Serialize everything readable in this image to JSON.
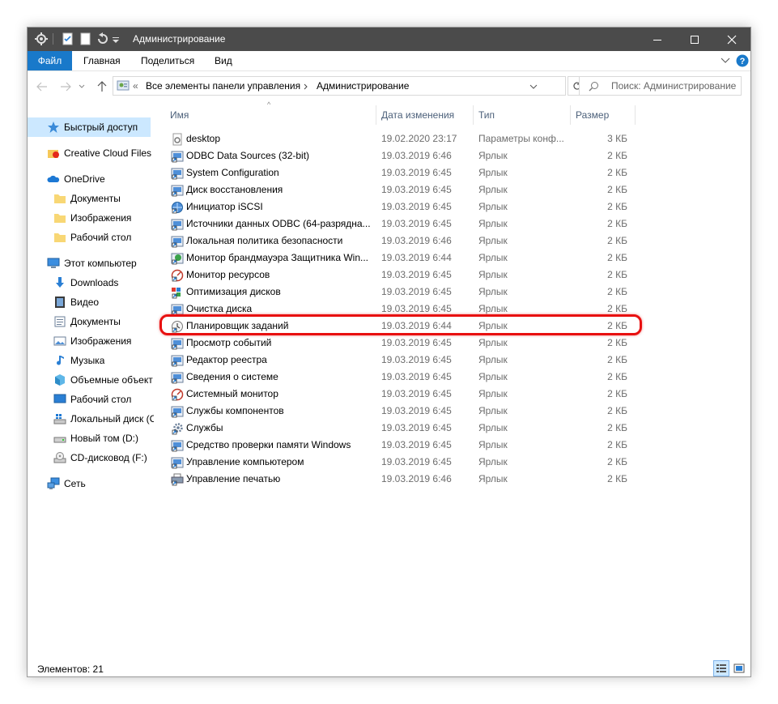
{
  "window": {
    "title": "Администрирование"
  },
  "ribbon": {
    "tabs": [
      "Файл",
      "Главная",
      "Поделиться",
      "Вид"
    ]
  },
  "address": {
    "crumbs": [
      "Все элементы панели управления",
      "Администрирование"
    ],
    "more_glyph": "«"
  },
  "search": {
    "placeholder": "Поиск: Администрирование"
  },
  "nav": {
    "items": [
      {
        "label": "Быстрый доступ",
        "icon": "star-icon",
        "selected": true
      },
      {
        "label": "Creative Cloud Files",
        "icon": "creative-cloud-icon"
      },
      {
        "label": "OneDrive",
        "icon": "onedrive-cloud-icon"
      },
      {
        "label": "Документы",
        "icon": "folder-icon"
      },
      {
        "label": "Изображения",
        "icon": "folder-icon"
      },
      {
        "label": "Рабочий стол",
        "icon": "folder-icon"
      },
      {
        "label": "Этот компьютер",
        "icon": "computer-icon"
      },
      {
        "label": "Downloads",
        "icon": "download-arrow-icon"
      },
      {
        "label": "Видео",
        "icon": "video-icon"
      },
      {
        "label": "Документы",
        "icon": "documents-icon"
      },
      {
        "label": "Изображения",
        "icon": "pictures-icon"
      },
      {
        "label": "Музыка",
        "icon": "music-icon"
      },
      {
        "label": "Объемные объект",
        "icon": "3d-objects-icon"
      },
      {
        "label": "Рабочий стол",
        "icon": "desktop-icon"
      },
      {
        "label": "Локальный диск (С",
        "icon": "windows-drive-icon"
      },
      {
        "label": "Новый том (D:)",
        "icon": "drive-icon"
      },
      {
        "label": "CD-дисковод (F:)",
        "icon": "cd-drive-icon"
      },
      {
        "label": "Сеть",
        "icon": "network-icon"
      }
    ]
  },
  "columns": {
    "name": "Имя",
    "date": "Дата изменения",
    "type": "Тип",
    "size": "Размер"
  },
  "files": [
    {
      "name": "desktop",
      "date": "19.02.2020 23:17",
      "type": "Параметры конф...",
      "size": "3 КБ",
      "icon": "settings-file-icon"
    },
    {
      "name": "ODBC Data Sources (32-bit)",
      "date": "19.03.2019 6:46",
      "type": "Ярлык",
      "size": "2 КБ",
      "icon": "shortcut-icon"
    },
    {
      "name": "System Configuration",
      "date": "19.03.2019 6:45",
      "type": "Ярлык",
      "size": "2 КБ",
      "icon": "shortcut-icon"
    },
    {
      "name": "Диск восстановления",
      "date": "19.03.2019 6:45",
      "type": "Ярлык",
      "size": "2 КБ",
      "icon": "shortcut-icon"
    },
    {
      "name": "Инициатор iSCSI",
      "date": "19.03.2019 6:45",
      "type": "Ярлык",
      "size": "2 КБ",
      "icon": "globe-shortcut-icon"
    },
    {
      "name": "Источники данных ODBC (64-разрядна...",
      "date": "19.03.2019 6:45",
      "type": "Ярлык",
      "size": "2 КБ",
      "icon": "shortcut-icon"
    },
    {
      "name": "Локальная политика безопасности",
      "date": "19.03.2019 6:46",
      "type": "Ярлык",
      "size": "2 КБ",
      "icon": "shortcut-icon"
    },
    {
      "name": "Монитор брандмауэра Защитника Win...",
      "date": "19.03.2019 6:44",
      "type": "Ярлык",
      "size": "2 КБ",
      "icon": "firewall-shortcut-icon"
    },
    {
      "name": "Монитор ресурсов",
      "date": "19.03.2019 6:45",
      "type": "Ярлык",
      "size": "2 КБ",
      "icon": "gauge-shortcut-icon"
    },
    {
      "name": "Оптимизация дисков",
      "date": "19.03.2019 6:45",
      "type": "Ярлык",
      "size": "2 КБ",
      "icon": "defrag-shortcut-icon"
    },
    {
      "name": "Очистка диска",
      "date": "19.03.2019 6:45",
      "type": "Ярлык",
      "size": "2 КБ",
      "icon": "shortcut-icon"
    },
    {
      "name": "Планировщик заданий",
      "date": "19.03.2019 6:44",
      "type": "Ярлык",
      "size": "2 КБ",
      "icon": "clock-shortcut-icon"
    },
    {
      "name": "Просмотр событий",
      "date": "19.03.2019 6:45",
      "type": "Ярлык",
      "size": "2 КБ",
      "icon": "shortcut-icon"
    },
    {
      "name": "Редактор реестра",
      "date": "19.03.2019 6:45",
      "type": "Ярлык",
      "size": "2 КБ",
      "icon": "shortcut-icon"
    },
    {
      "name": "Сведения о системе",
      "date": "19.03.2019 6:45",
      "type": "Ярлык",
      "size": "2 КБ",
      "icon": "shortcut-icon"
    },
    {
      "name": "Системный монитор",
      "date": "19.03.2019 6:45",
      "type": "Ярлык",
      "size": "2 КБ",
      "icon": "gauge-shortcut-icon"
    },
    {
      "name": "Службы компонентов",
      "date": "19.03.2019 6:45",
      "type": "Ярлык",
      "size": "2 КБ",
      "icon": "shortcut-icon"
    },
    {
      "name": "Службы",
      "date": "19.03.2019 6:45",
      "type": "Ярлык",
      "size": "2 КБ",
      "icon": "gear-shortcut-icon"
    },
    {
      "name": "Средство проверки памяти Windows",
      "date": "19.03.2019 6:45",
      "type": "Ярлык",
      "size": "2 КБ",
      "icon": "shortcut-icon"
    },
    {
      "name": "Управление компьютером",
      "date": "19.03.2019 6:45",
      "type": "Ярлык",
      "size": "2 КБ",
      "icon": "shortcut-icon"
    },
    {
      "name": "Управление печатью",
      "date": "19.03.2019 6:46",
      "type": "Ярлык",
      "size": "2 КБ",
      "icon": "printer-shortcut-icon"
    }
  ],
  "highlighted_file": "Планировщик заданий",
  "status": {
    "text": "Элементов: 21"
  },
  "colors": {
    "titlebar": "#4b4b4b",
    "file_tab": "#1979ca",
    "selection": "#cce8ff",
    "highlight": "#e81010"
  }
}
